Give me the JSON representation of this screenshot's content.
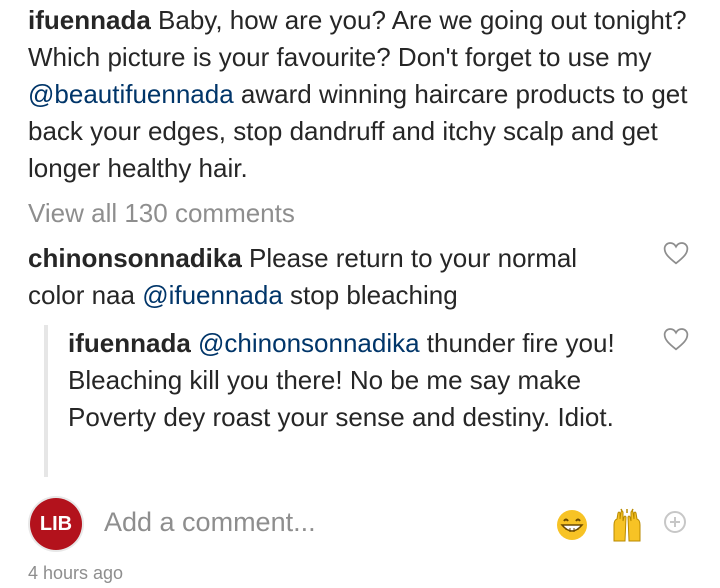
{
  "caption": {
    "username": "ifuennada",
    "text_1": " Baby, how are you? Are we going out tonight? Which picture is your favourite? Don't forget to use my ",
    "mention": "@beautifuennada",
    "text_2": " award winning haircare products to get back your edges, stop dandruff and itchy scalp and get longer healthy hair."
  },
  "view_all": "View all 130 comments",
  "comment": {
    "username": "chinonsonnadika",
    "text_1": " Please return to your normal color naa ",
    "mention": "@ifuennada",
    "text_2": " stop bleaching"
  },
  "reply": {
    "username": "ifuennada",
    "mention": "@chinonsonnadika",
    "text": " thunder fire you! Bleaching kill you there! No be me say make Poverty dey roast your sense and destiny. Idiot."
  },
  "composer": {
    "avatar_text": "LIB",
    "placeholder": "Add a comment...",
    "icons": [
      "grinning-emoji",
      "raised-hands-emoji",
      "add-circle-icon"
    ]
  },
  "timestamp": "4 hours ago",
  "colors": {
    "mention": "#003569",
    "muted": "#8e8e8e",
    "avatar_bg": "#b3121c"
  }
}
